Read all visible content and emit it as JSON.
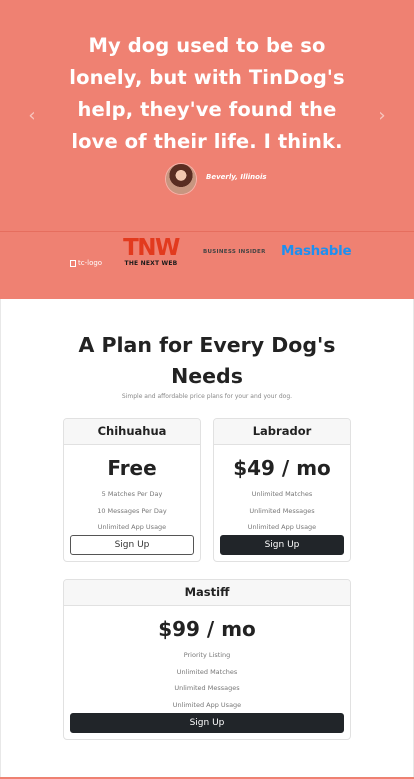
{
  "testimonial": {
    "quote": "My dog used to be so lonely, but with TinDog's help, they've found the love of their life. I think.",
    "author": "Beverly, Illinois",
    "prev_arrow": "‹",
    "next_arrow": "›"
  },
  "press": {
    "tc_alt": "tc-logo",
    "tnw_big": "TNW",
    "tnw_small": "THE NEXT WEB",
    "business_insider": "BUSINESS INSIDER",
    "mashable": "Mashable"
  },
  "pricing": {
    "title": "A Plan for Every Dog's Needs",
    "subtitle": "Simple and affordable price plans for your and your dog.",
    "plans": [
      {
        "name": "Chihuahua",
        "price": "Free",
        "features": [
          "5 Matches Per Day",
          "10 Messages Per Day",
          "Unlimited App Usage"
        ],
        "button": "Sign Up"
      },
      {
        "name": "Labrador",
        "price": "$49 / mo",
        "features": [
          "Unlimited Matches",
          "Unlimited Messages",
          "Unlimited App Usage"
        ],
        "button": "Sign Up"
      },
      {
        "name": "Mastiff",
        "price": "$99 / mo",
        "features": [
          "Priority Listing",
          "Unlimited Matches",
          "Unlimited Messages",
          "Unlimited App Usage"
        ],
        "button": "Sign Up"
      }
    ]
  },
  "colors": {
    "hero_bg": "#ef8172",
    "dark_button": "#212529",
    "tnw_red": "#e23a1e",
    "mashable_blue": "#1e8ff0"
  }
}
